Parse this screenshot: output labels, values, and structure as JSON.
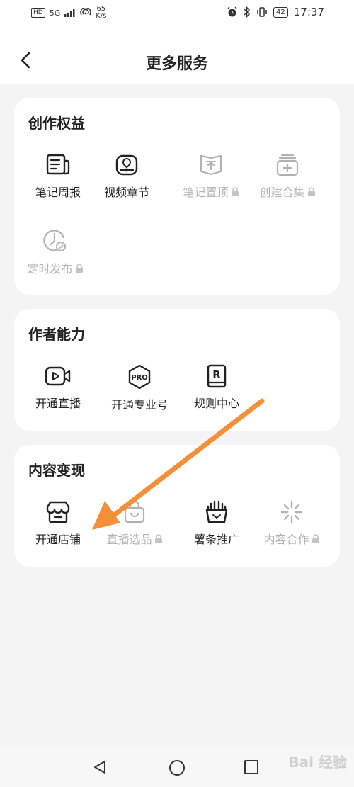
{
  "status_bar": {
    "hd": "HD",
    "net_label": "5G",
    "speed_value": "65",
    "speed_unit": "K/s",
    "battery": "42",
    "time": "17:37"
  },
  "header": {
    "title": "更多服务"
  },
  "sections": [
    {
      "title": "创作权益",
      "items": [
        {
          "label": "笔记周报",
          "icon": "note-report-icon",
          "locked": false
        },
        {
          "label": "视频章节",
          "icon": "video-chapter-icon",
          "locked": false
        },
        {
          "label": "笔记置顶",
          "icon": "pin-top-icon",
          "locked": true
        },
        {
          "label": "创建合集",
          "icon": "create-collection-icon",
          "locked": true
        },
        {
          "label": "定时发布",
          "icon": "scheduled-publish-icon",
          "locked": true
        }
      ]
    },
    {
      "title": "作者能力",
      "items": [
        {
          "label": "开通直播",
          "icon": "live-stream-icon",
          "locked": false
        },
        {
          "label": "开通专业号",
          "icon": "pro-account-icon",
          "locked": false
        },
        {
          "label": "规则中心",
          "icon": "rules-center-icon",
          "locked": false
        }
      ]
    },
    {
      "title": "内容变现",
      "items": [
        {
          "label": "开通店铺",
          "icon": "shop-icon",
          "locked": false
        },
        {
          "label": "直播选品",
          "icon": "shopping-bag-icon",
          "locked": true
        },
        {
          "label": "薯条推广",
          "icon": "fries-promotion-icon",
          "locked": false
        },
        {
          "label": "内容合作",
          "icon": "cooperation-icon",
          "locked": true
        }
      ]
    }
  ],
  "pro_badge_text": "PRO",
  "rules_badge_text": "R",
  "colors": {
    "accent_arrow": "#f4903a",
    "disabled": "#b2b2b2",
    "text": "#222222"
  },
  "watermark": "Bai 经验"
}
